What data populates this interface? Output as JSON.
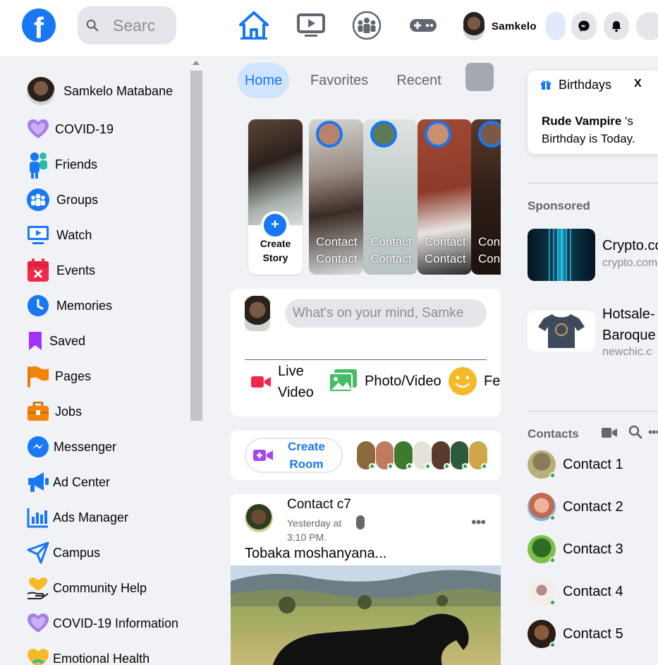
{
  "topbar": {
    "logo": "f",
    "search_placeholder": "Searc",
    "user_name": "Samkelo",
    "nav_icons": [
      "home-icon",
      "watch-icon",
      "groups-icon",
      "gaming-icon"
    ]
  },
  "left_menu": {
    "profile_name": "Samkelo Matabane",
    "items": [
      {
        "label": "COVID-19",
        "icon": "covid-heart-icon"
      },
      {
        "label": "Friends",
        "icon": "friends-icon"
      },
      {
        "label": "Groups",
        "icon": "groups-icon"
      },
      {
        "label": "Watch",
        "icon": "watch-icon"
      },
      {
        "label": "Events",
        "icon": "events-icon"
      },
      {
        "label": "Memories",
        "icon": "memories-clock-icon"
      },
      {
        "label": "Saved",
        "icon": "saved-bookmark-icon"
      },
      {
        "label": "Pages",
        "icon": "pages-flag-icon"
      },
      {
        "label": "Jobs",
        "icon": "jobs-briefcase-icon"
      },
      {
        "label": "Messenger",
        "icon": "messenger-icon"
      },
      {
        "label": "Ad Center",
        "icon": "ad-center-megaphone-icon"
      },
      {
        "label": "Ads Manager",
        "icon": "ads-manager-chart-icon"
      },
      {
        "label": "Campus",
        "icon": "campus-icon"
      },
      {
        "label": "Community Help",
        "icon": "community-help-icon"
      },
      {
        "label": "COVID-19 Information",
        "icon": "covid-info-heart-icon"
      },
      {
        "label": "Emotional Health",
        "icon": "emotional-health-icon"
      }
    ]
  },
  "feed_tabs": {
    "home": "Home",
    "favorites": "Favorites",
    "recent": "Recent"
  },
  "stories": {
    "create_label_1": "Create",
    "create_label_2": "Story",
    "items": [
      {
        "line1": "Contact",
        "line2": "Contact"
      },
      {
        "line1": "Contact",
        "line2": "Contact"
      },
      {
        "line1": "Contact",
        "line2": "Contact"
      },
      {
        "line1": "Con",
        "line2": "Con"
      }
    ]
  },
  "composer": {
    "placeholder": "What's on your mind, Samke",
    "live_1": "Live",
    "live_2": "Video",
    "photo": "Photo/Video",
    "feeling": "Fe"
  },
  "rooms": {
    "label_1": "Create",
    "label_2": "Room"
  },
  "post": {
    "author": "Contact c7",
    "time_1": "Yesterday at",
    "time_2": "3:10 PM.",
    "text": "Tobaka moshanyana..."
  },
  "birthdays": {
    "title": "Birthdays",
    "close": "X",
    "name": "Rude Vampire",
    "suffix": " 's",
    "line2": "Birthday is Today."
  },
  "sponsored": {
    "heading": "Sponsored",
    "ads": [
      {
        "title": "Crypto.co",
        "domain": "crypto.com"
      },
      {
        "title_1": "Hotsale-",
        "title_2": "Baroque",
        "domain": "newchic.c"
      }
    ]
  },
  "contacts": {
    "heading": "Contacts",
    "list": [
      "Contact 1",
      "Contact 2",
      "Contact 3",
      "Contact 4",
      "Contact 5"
    ]
  },
  "colors": {
    "brand": "#1877f2",
    "online": "#31a24c",
    "background": "#f0f2f5"
  }
}
